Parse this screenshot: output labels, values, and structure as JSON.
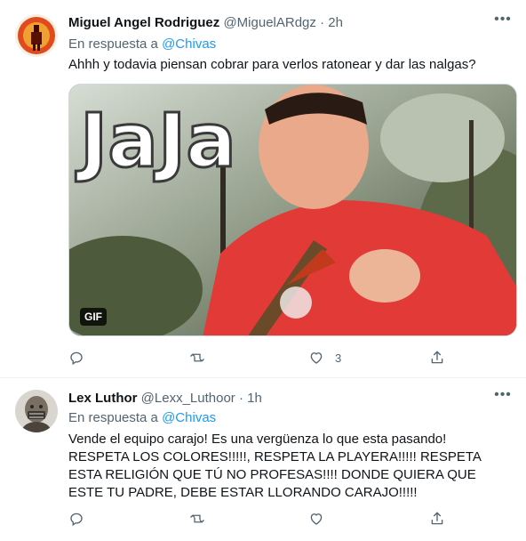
{
  "tweets": [
    {
      "author_name": "Miguel Angel Rodriguez",
      "handle": "@MiguelARdgz",
      "separator": "·",
      "time": "2h",
      "reply_prefix": "En respuesta a",
      "reply_mention": "@Chivas",
      "text": "Ahhh y todavia piensan cobrar para verlos ratonear y dar las nalgas?",
      "media": {
        "overlay_text": "JaJa",
        "badge": "GIF"
      },
      "like_count": "3",
      "more_icon": "more-horizontal-icon",
      "colors": {
        "avatar_bg": "#e14a1e"
      }
    },
    {
      "author_name": "Lex Luthor",
      "handle": "@Lexx_Luthoor",
      "separator": "·",
      "time": "1h",
      "reply_prefix": "En respuesta a",
      "reply_mention": "@Chivas",
      "text": "Vende el equipo carajo! Es una vergüenza lo que esta pasando! RESPETA LOS COLORES!!!!!, RESPETA LA PLAYERA!!!!! RESPETA ESTA RELIGIÓN QUE TÚ NO PROFESAS!!!! DONDE QUIERA QUE ESTE TU PADRE, DEBE ESTAR LLORANDO CARAJO!!!!!",
      "like_count": "",
      "more_icon": "more-horizontal-icon",
      "colors": {
        "avatar_bg": "#6f6a62"
      }
    }
  ],
  "action_icons": [
    "reply-icon",
    "retweet-icon",
    "like-icon",
    "share-icon"
  ],
  "colors": {
    "link": "#1d9bf0",
    "secondary_text": "#536471",
    "primary_text": "#0f1419"
  }
}
